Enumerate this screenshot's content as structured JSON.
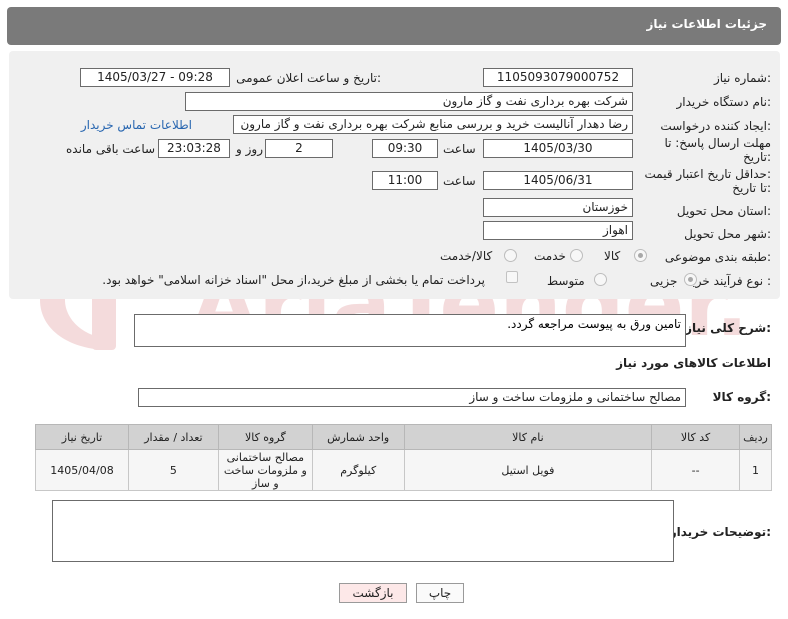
{
  "header": {
    "title": "جزئیات اطلاعات نیاز"
  },
  "fields": {
    "need_number_label": "شماره نیاز:",
    "need_number": "1105093079000752",
    "announce_label": "تاریخ و ساعت اعلان عمومی:",
    "announce_value": "1405/03/27 - 09:28",
    "buyer_org_label": "نام دستگاه خریدار:",
    "buyer_org": "شرکت بهره برداری نفت و گاز مارون",
    "creator_label": "ایجاد کننده درخواست:",
    "creator": "رضا دهدار آنالیست خرید و بررسی منابع شرکت بهره برداری نفت و گاز مارون",
    "contact_link": "اطلاعات تماس خریدار",
    "reply_deadline_label_1": "مهلت ارسال پاسخ: تا",
    "reply_deadline_label_2": "تاریخ:",
    "reply_date": "1405/03/30",
    "time_label": "ساعت",
    "reply_time": "09:30",
    "days_value": "2",
    "days_label": "روز و",
    "remaining_time": "23:03:28",
    "remaining_label": "ساعت باقی مانده",
    "price_deadline_label_1": "حداقل تاریخ اعتبار قیمت:",
    "price_deadline_label_2": "تا تاریخ:",
    "price_date": "1405/06/31",
    "price_time": "11:00",
    "province_label": "استان محل تحویل:",
    "province": "خوزستان",
    "city_label": "شهر محل تحویل:",
    "city": "اهواز",
    "category_label": "طبقه بندی موضوعی:",
    "category_options": [
      "کالا",
      "خدمت",
      "کالا/خدمت"
    ],
    "process_label": "نوع فرآیند خرید :",
    "process_options": [
      "جزیی",
      "متوسط"
    ],
    "payment_note": "پرداخت تمام یا بخشی از مبلغ خرید،از محل \"اسناد خزانه اسلامی\" خواهد بود."
  },
  "description": {
    "label": "شرح کلی نیاز:",
    "value": "تامین ورق به پیوست مراجعه گردد."
  },
  "goods_section": {
    "title": "اطلاعات کالاهای مورد نیاز",
    "group_label": "گروه کالا:",
    "group_value": "مصالح ساختمانی و ملزومات ساخت و ساز"
  },
  "table": {
    "headers": [
      "ردیف",
      "کد کالا",
      "نام کالا",
      "واحد شمارش",
      "گروه کالا",
      "تعداد / مقدار",
      "تاریخ نیاز"
    ],
    "rows": [
      [
        "1",
        "--",
        "فویل استیل",
        "کیلوگرم",
        "مصالح ساختمانی و ملزومات ساخت و ساز",
        "5",
        "1405/04/08"
      ]
    ]
  },
  "buyer_notes": {
    "label": "توضیحات خریدار:",
    "value": ""
  },
  "buttons": {
    "print": "چاپ",
    "back": "بازگشت"
  },
  "watermark": "AriaTender.net",
  "colors": {
    "header_bg": "#7a7a7a",
    "panel_bg": "#f0f0f0",
    "link": "#2866b0",
    "back_button_bg": "#fde8e8",
    "watermark": "#c0282d"
  }
}
